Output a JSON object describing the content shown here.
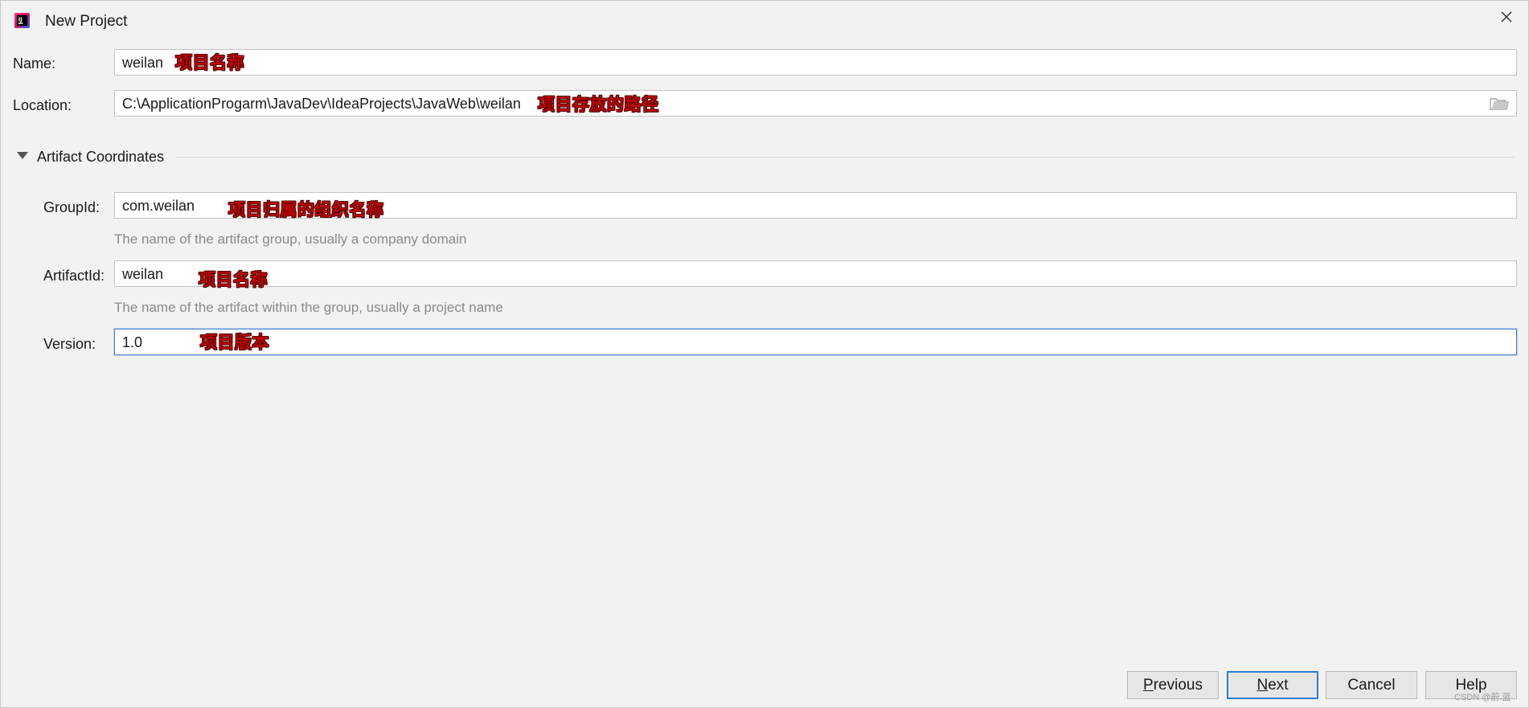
{
  "window": {
    "title": "New Project",
    "icon": "intellij-idea-icon"
  },
  "form": {
    "name": {
      "label": "Name:",
      "value": "weilan",
      "annotation": "项目名称"
    },
    "location": {
      "label": "Location:",
      "value": "C:\\ApplicationProgarm\\JavaDev\\IdeaProjects\\JavaWeb\\weilan",
      "annotation": "项目存放的路径",
      "browse_icon": "folder-icon"
    }
  },
  "artifact_section": {
    "title": "Artifact Coordinates",
    "expanded": true,
    "group_id": {
      "label": "GroupId:",
      "value": "com.weilan",
      "annotation": "项目归属的组织名称",
      "hint": "The name of the artifact group, usually a company domain"
    },
    "artifact_id": {
      "label": "ArtifactId:",
      "value": "weilan",
      "annotation": "项目名称",
      "hint": "The name of the artifact within the group, usually a project name"
    },
    "version": {
      "label": "Version:",
      "value": "1.0",
      "annotation": "项目版本"
    }
  },
  "buttons": {
    "previous_mnemonic": "P",
    "previous_rest": "revious",
    "next_mnemonic": "N",
    "next_rest": "ext",
    "cancel": "Cancel",
    "help": "Help"
  },
  "watermark": "CSDN @蔚.蓝",
  "colors": {
    "background": "#f2f2f2",
    "annotation": "#c00000",
    "focus_border": "#3d7fd6",
    "default_button_border": "#2f7bd0"
  }
}
